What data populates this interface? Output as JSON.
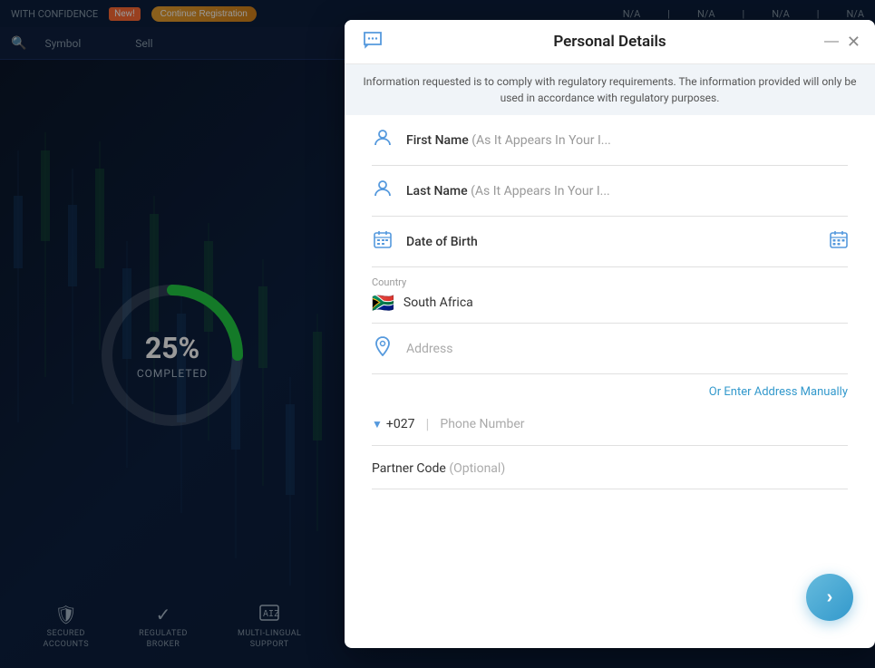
{
  "platform": {
    "confidence_text": "WITH CONFIDENCE",
    "new_badge": "New!",
    "continue_btn": "Continue Registration",
    "nav_values": [
      "N/A",
      "N/A",
      "N/A",
      "N/A"
    ],
    "column_headers": [
      "Symbol",
      "Sell"
    ],
    "progress_percent": "25%",
    "progress_completed_label": "COMPLETED",
    "bottom_icons": [
      {
        "label": "SECURED\nACCOUNTS",
        "icon": "🛡"
      },
      {
        "label": "REGULATED\nBROKER",
        "icon": "✓"
      },
      {
        "label": "MULTI-LINGUAL\nSUPPORT",
        "icon": "🔤"
      }
    ]
  },
  "modal": {
    "title": "Personal Details",
    "info_text": "Information requested is to comply with regulatory requirements. The information\nprovided will only be used in accordance with regulatory purposes.",
    "fields": {
      "first_name_label": "First Name",
      "first_name_placeholder": "(As It Appears In Your I...",
      "last_name_label": "Last Name",
      "last_name_placeholder": "(As It Appears In Your I...",
      "dob_label": "Date of Birth",
      "country_label": "Country",
      "country_value": "South Africa",
      "country_flag": "🇿🇦",
      "address_placeholder": "Address",
      "manual_address_link": "Or Enter Address Manually",
      "phone_code": "+027",
      "phone_placeholder": "Phone Number",
      "partner_label": "Partner Code",
      "partner_optional": "(Optional)"
    },
    "next_btn_label": "→"
  }
}
